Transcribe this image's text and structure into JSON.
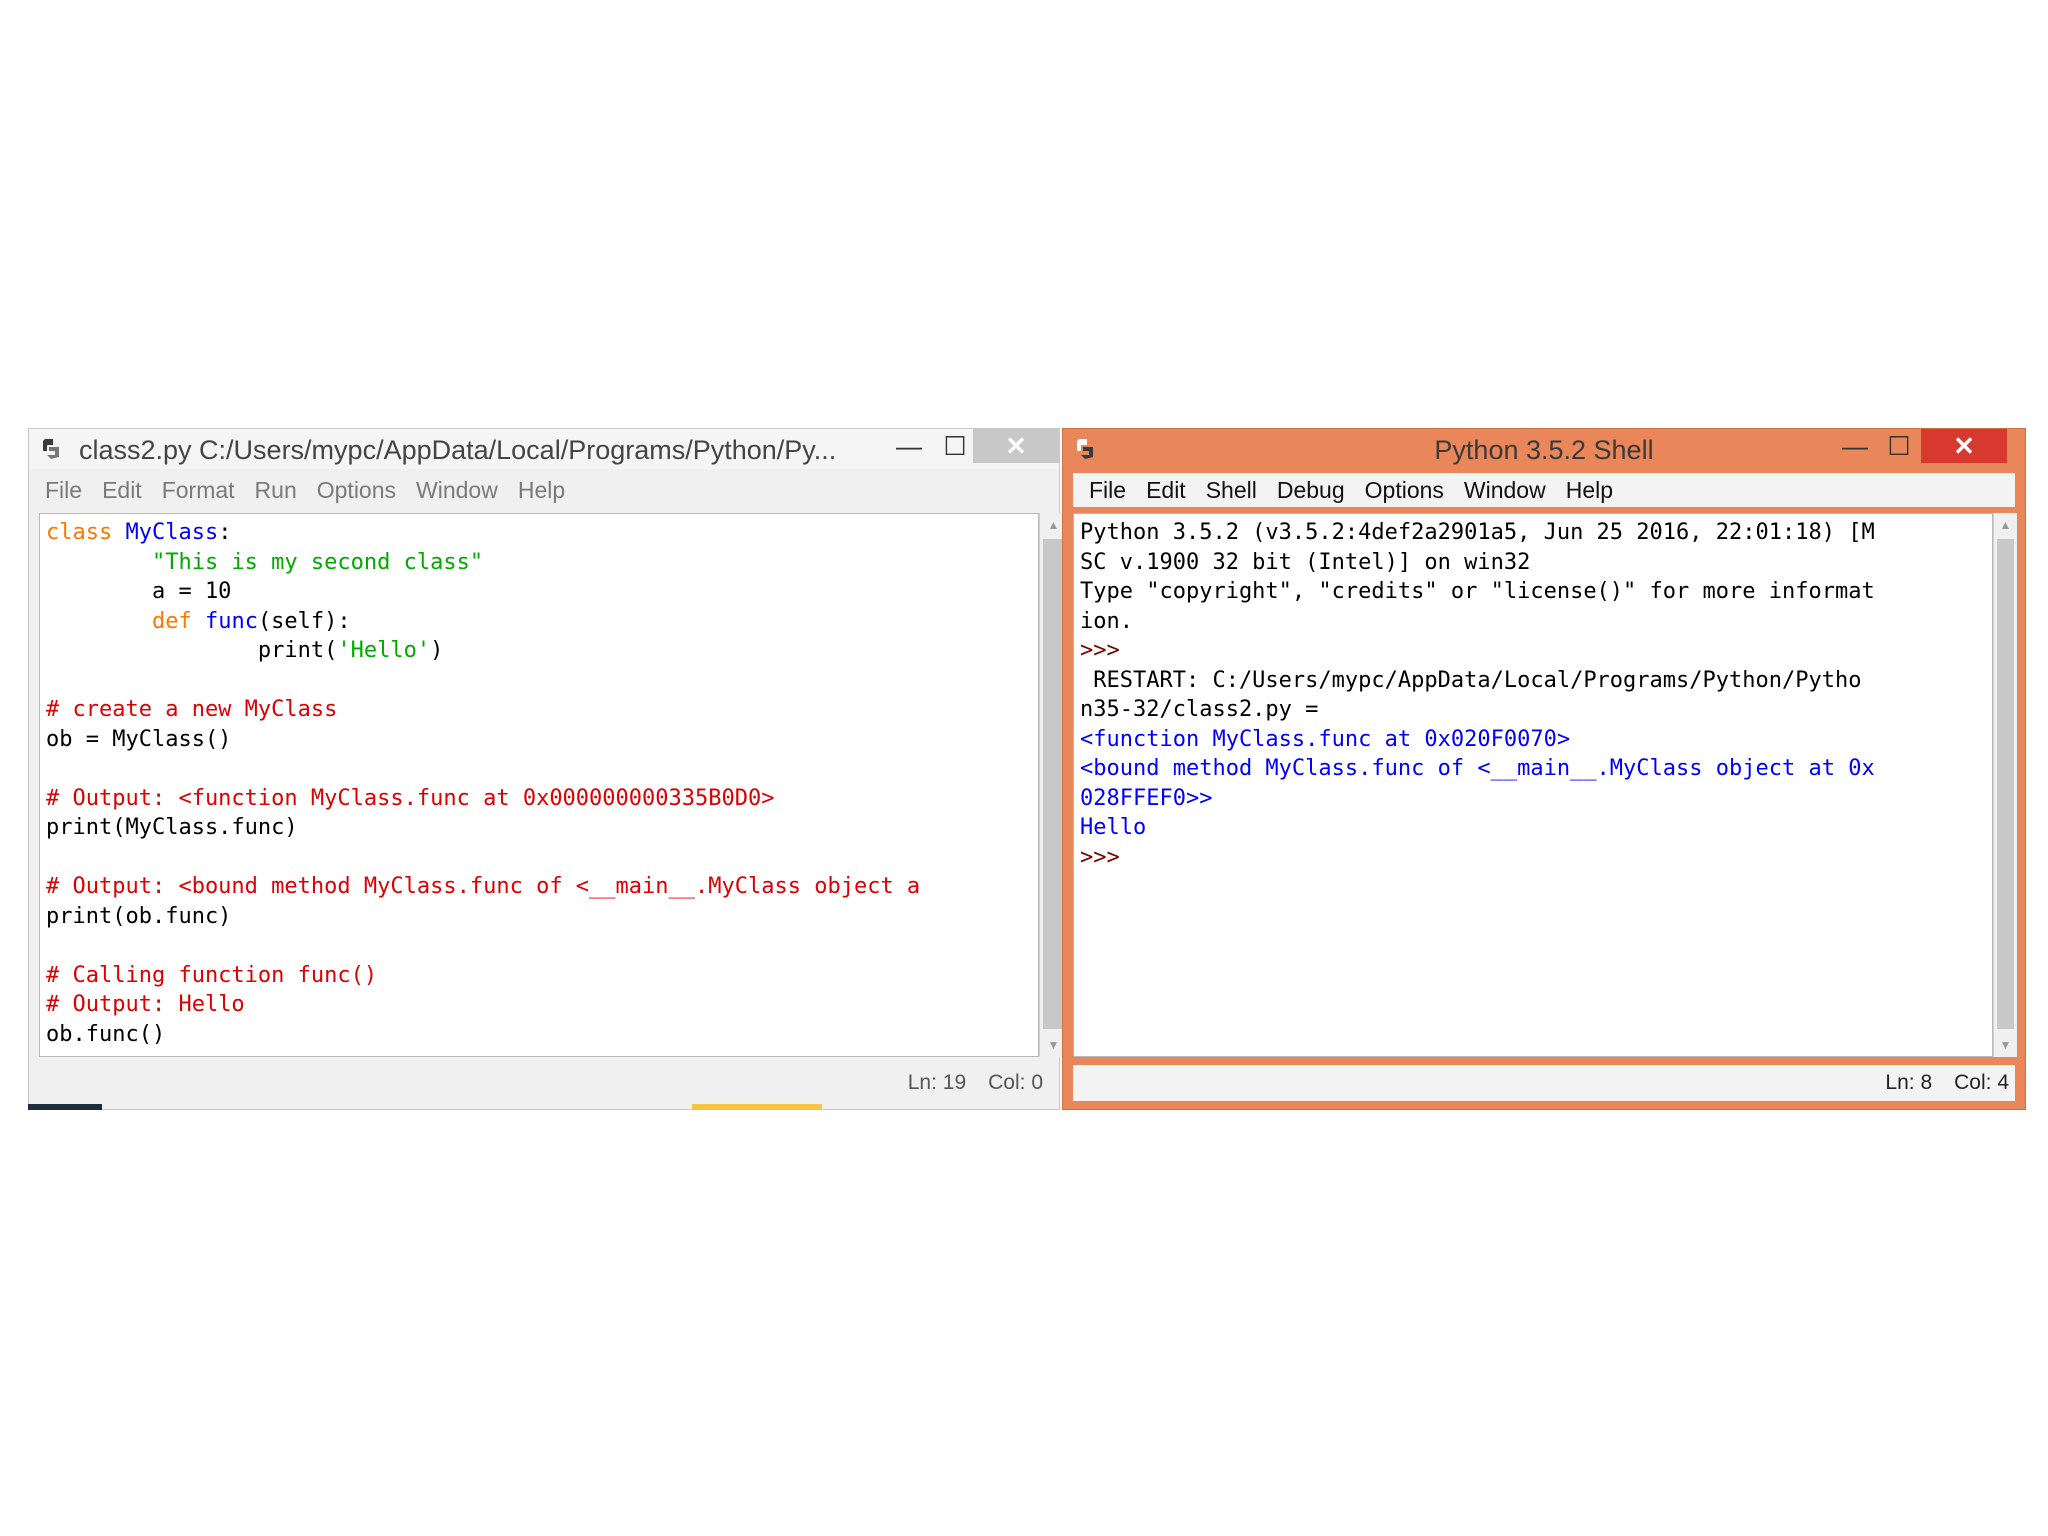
{
  "editor": {
    "title": "class2.py    C:/Users/mypc/AppData/Local/Programs/Python/Py...",
    "menu": [
      "File",
      "Edit",
      "Format",
      "Run",
      "Options",
      "Window",
      "Help"
    ],
    "status": {
      "ln": "Ln: 19",
      "col": "Col: 0"
    },
    "code": [
      [
        {
          "c": "kw",
          "t": "class "
        },
        {
          "c": "nm",
          "t": "MyClass"
        },
        {
          "c": "txt",
          "t": ":"
        }
      ],
      [
        {
          "c": "str",
          "t": "        \"This is my second class\""
        }
      ],
      [
        {
          "c": "txt",
          "t": "        a = 10"
        }
      ],
      [
        {
          "c": "kw",
          "t": "        def "
        },
        {
          "c": "nm",
          "t": "func"
        },
        {
          "c": "txt",
          "t": "(self):"
        }
      ],
      [
        {
          "c": "txt",
          "t": "                print("
        },
        {
          "c": "str",
          "t": "'Hello'"
        },
        {
          "c": "txt",
          "t": ")"
        }
      ],
      [
        {
          "c": "txt",
          "t": ""
        }
      ],
      [
        {
          "c": "cm",
          "t": "# create a new MyClass"
        }
      ],
      [
        {
          "c": "txt",
          "t": "ob = MyClass()"
        }
      ],
      [
        {
          "c": "txt",
          "t": ""
        }
      ],
      [
        {
          "c": "cm",
          "t": "# Output: <function MyClass.func at 0x000000000335B0D0>"
        }
      ],
      [
        {
          "c": "txt",
          "t": "print(MyClass.func)"
        }
      ],
      [
        {
          "c": "txt",
          "t": ""
        }
      ],
      [
        {
          "c": "cm",
          "t": "# Output: <bound method MyClass.func of <__main__.MyClass object a"
        }
      ],
      [
        {
          "c": "txt",
          "t": "print(ob.func)"
        }
      ],
      [
        {
          "c": "txt",
          "t": ""
        }
      ],
      [
        {
          "c": "cm",
          "t": "# Calling function func()"
        }
      ],
      [
        {
          "c": "cm",
          "t": "# Output: Hello"
        }
      ],
      [
        {
          "c": "txt",
          "t": "ob.func()"
        }
      ]
    ]
  },
  "shell": {
    "title": "Python 3.5.2 Shell",
    "menu": [
      "File",
      "Edit",
      "Shell",
      "Debug",
      "Options",
      "Window",
      "Help"
    ],
    "status": {
      "ln": "Ln: 8",
      "col": "Col: 4"
    },
    "lines": [
      [
        {
          "c": "txt",
          "t": "Python 3.5.2 (v3.5.2:4def2a2901a5, Jun 25 2016, 22:01:18) [M"
        }
      ],
      [
        {
          "c": "txt",
          "t": "SC v.1900 32 bit (Intel)] on win32"
        }
      ],
      [
        {
          "c": "txt",
          "t": "Type \"copyright\", \"credits\" or \"license()\" for more informat"
        }
      ],
      [
        {
          "c": "txt",
          "t": "ion."
        }
      ],
      [
        {
          "c": "prompt",
          "t": ">>> "
        }
      ],
      [
        {
          "c": "txt",
          "t": " RESTART: C:/Users/mypc/AppData/Local/Programs/Python/Pytho"
        }
      ],
      [
        {
          "c": "txt",
          "t": "n35-32/class2.py ="
        }
      ],
      [
        {
          "c": "out",
          "t": "<function MyClass.func at 0x020F0070>"
        }
      ],
      [
        {
          "c": "out",
          "t": "<bound method MyClass.func of <__main__.MyClass object at 0x"
        }
      ],
      [
        {
          "c": "out",
          "t": "028FFEF0>>"
        }
      ],
      [
        {
          "c": "out",
          "t": "Hello"
        }
      ],
      [
        {
          "c": "prompt",
          "t": ">>> "
        }
      ]
    ]
  }
}
